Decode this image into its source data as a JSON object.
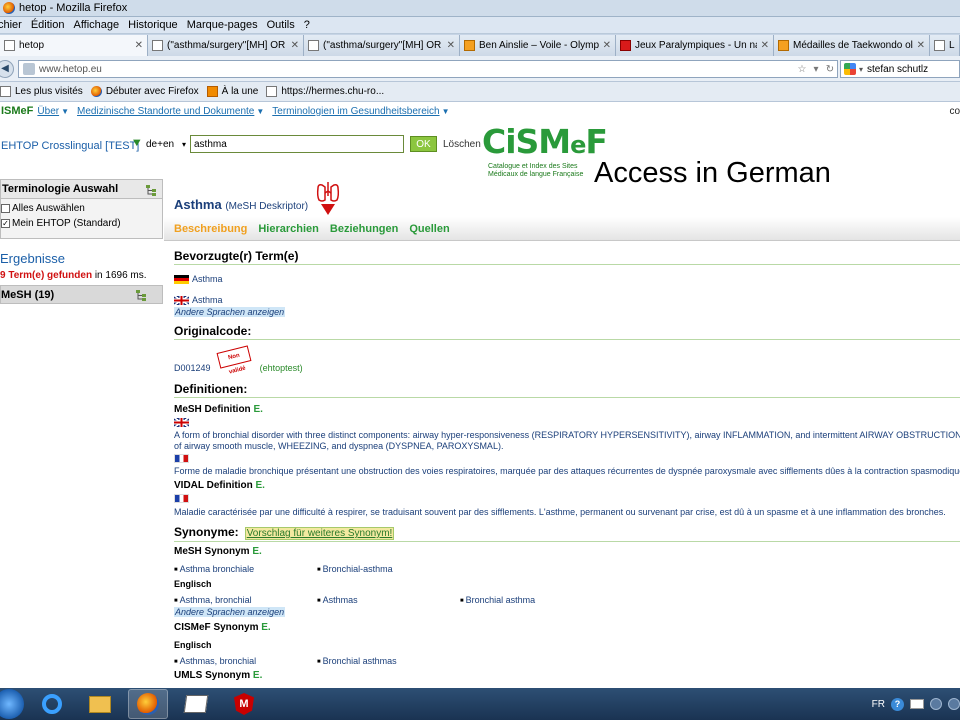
{
  "window": {
    "title": "hetop - Mozilla Firefox"
  },
  "menubar": {
    "items": [
      "chier",
      "Édition",
      "Affichage",
      "Historique",
      "Marque-pages",
      "Outils",
      "?"
    ]
  },
  "tabs": [
    {
      "label": "hetop",
      "icon": "page-icon",
      "active": true
    },
    {
      "label": "(\"asthma/surgery\"[MH] OR (((\"a...",
      "icon": "page-icon"
    },
    {
      "label": "(\"asthma/surgery\"[MH] OR (((\"a...",
      "icon": "page-icon"
    },
    {
      "label": "Ben Ainslie – Voile - Olympique ...",
      "icon": "orange-icon"
    },
    {
      "label": "Jeux Paralympiques - Un nageur ...",
      "icon": "red-icon"
    },
    {
      "label": "Médailles de Taekwondo olympi...",
      "icon": "orange-icon"
    },
    {
      "label": "List",
      "icon": "page-icon"
    }
  ],
  "navbar": {
    "url": "www.hetop.eu",
    "search_value": "stefan schutlz"
  },
  "bookmarks": [
    {
      "label": "Les plus visités",
      "icon": "page-icon"
    },
    {
      "label": "Débuter avec Firefox",
      "icon": "firefox-icon"
    },
    {
      "label": "À la une",
      "icon": "rss-icon"
    },
    {
      "label": "https://hermes.chu-ro...",
      "icon": "blank-page-icon"
    }
  ],
  "topnav": {
    "brand": "ISMeF",
    "items": [
      "Über",
      "Medizinische Standorte und Dokumente",
      "Terminologien im Gesundheitsbereich"
    ],
    "right": "co"
  },
  "search": {
    "app_title": "EHTOP Crosslingual [TEST]",
    "lang": "de+en",
    "query": "asthma",
    "ok_label": "OK",
    "clear_label": "Löschen"
  },
  "logo": {
    "name_main": "CiSM",
    "name_e": "e",
    "name_end": "F",
    "sub_line1": "Catalogue et Index des Sites",
    "sub_line2": "Médicaux de langue Française"
  },
  "annotation": "Access in German",
  "sidebar": {
    "panel_title": "Terminologie Auswahl",
    "options": [
      {
        "label": "Alles Auswählen",
        "checked": false
      },
      {
        "label": "Mein EHTOP (Standard)",
        "checked": true
      }
    ],
    "results_title": "Ergebnisse",
    "results_count": "9 Term(e) gefunden",
    "results_time": " in 1696 ms.",
    "mesh_label": "MeSH (19)"
  },
  "concept": {
    "title": "Asthma",
    "subtitle": "(MeSH Deskriptor)",
    "tabs": [
      {
        "label": "Beschreibung",
        "active": true
      },
      {
        "label": "Hierarchien"
      },
      {
        "label": "Beziehungen"
      },
      {
        "label": "Quellen"
      }
    ]
  },
  "preferred": {
    "heading": "Bevorzugte(r) Term(e)",
    "de_term": "Asthma",
    "en_term": "Asthma",
    "other_langs": "Andere Sprachen anzeigen"
  },
  "original_code": {
    "heading": "Originalcode:",
    "code": "D001249",
    "stamp": "Non validé",
    "source": "(ehtoptest)"
  },
  "definitions": {
    "heading": "Definitionen:",
    "mesh_title": "MeSH Definition",
    "mesh_marker": "E.",
    "mesh_en_line1": "A form of bronchial disorder with three distinct components: airway hyper-responsiveness (RESPIRATORY HYPERSENSITIVITY), airway INFLAMMATION, and intermittent AIRWAY OBSTRUCTION. It is charac",
    "mesh_en_line2": "of airway smooth muscle, WHEEZING, and dyspnea (DYSPNEA, PAROXYSMAL).",
    "mesh_fr": "Forme de maladie bronchique présentant une obstruction des voies respiratoires, marquée par des attaques récurrentes de dyspnée paroxysmale avec sifflements dûes à la contraction spasmodique des b",
    "vidal_title": "VIDAL Definition",
    "vidal_marker": "E.",
    "vidal_fr": "Maladie caractérisée par une difficulté à respirer, se traduisant souvent par des sifflements. L'asthme, permanent ou survenant par crise, est dû à un spasme et à une inflammation des bronches."
  },
  "synonyms": {
    "heading": "Synonyme:",
    "suggest_link": "Vorschlag für weiteres Synonym!",
    "mesh_title": "MeSH Synonym",
    "mesh_marker": "E.",
    "mesh_de": [
      "Asthma bronchiale",
      "Bronchial-asthma"
    ],
    "english_label": "Englisch",
    "mesh_en": [
      "Asthma, bronchial",
      "Asthmas",
      "Bronchial asthma"
    ],
    "other_langs": "Andere Sprachen anzeigen",
    "cismef_title": "CISMeF Synonym",
    "cismef_marker": "E.",
    "cismef_english_label": "Englisch",
    "cismef_en": [
      "Asthmas, bronchial",
      "Bronchial asthmas"
    ],
    "umls_title": "UMLS Synonym",
    "umls_marker": "E."
  },
  "taskbar": {
    "lang": "FR"
  }
}
